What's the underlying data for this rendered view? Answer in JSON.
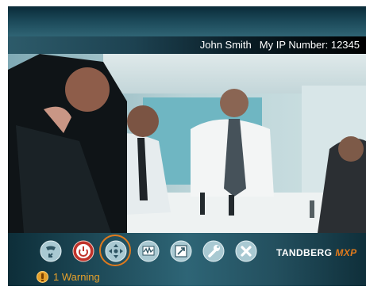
{
  "header": {
    "user_name": "John Smith",
    "ip_label": "My IP Number: 12345"
  },
  "toolbar": {
    "items": [
      {
        "name": "call-icon",
        "glyph": "phone"
      },
      {
        "name": "disconnect-icon",
        "glyph": "power"
      },
      {
        "name": "camera-control-icon",
        "glyph": "arrows",
        "selected": true
      },
      {
        "name": "presentation-icon",
        "glyph": "waveform"
      },
      {
        "name": "picture-layout-icon",
        "glyph": "picture"
      },
      {
        "name": "settings-icon",
        "glyph": "wrench"
      },
      {
        "name": "close-icon",
        "glyph": "x"
      }
    ]
  },
  "brand": {
    "name": "TANDBERG",
    "suffix": "MXP"
  },
  "status": {
    "warning_text": "1 Warning"
  },
  "colors": {
    "accent": "#e07a1c",
    "warning": "#e6a02a",
    "bar": "#1e4a58",
    "button": "#b7d4dc",
    "disconnect": "#c0322a"
  }
}
